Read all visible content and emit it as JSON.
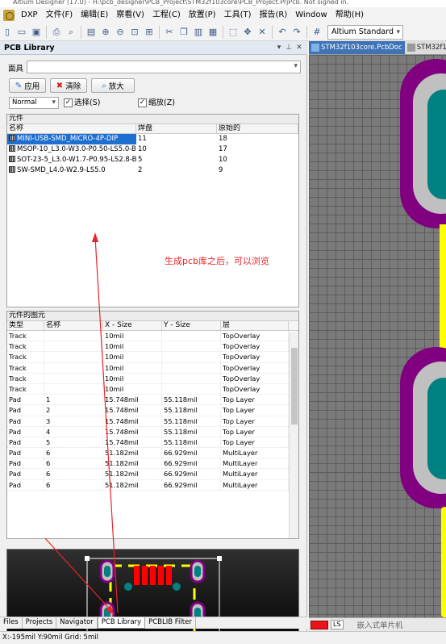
{
  "window": {
    "title_fragment": "Altium Designer (17.0) - H:\\pcb_designer\\PCB_Project\\STM32f103core\\PCB_Project.PrjPcb. Not signed in."
  },
  "menu": [
    "DXP",
    "文件(F)",
    "编辑(E)",
    "察看(V)",
    "工程(C)",
    "放置(P)",
    "工具(T)",
    "报告(R)",
    "Window",
    "帮助(H)"
  ],
  "toolbar": {
    "view_mode": "Altium Standard 2D"
  },
  "panel": {
    "title": "PCB Library",
    "mask_label": "面具",
    "mask_value": "",
    "buttons": {
      "apply": "应用",
      "clear": "清除",
      "magnify": "放大"
    },
    "mode": "Normal",
    "checkbox_select": "选择(S)",
    "checkbox_zoom": "缩放(Z)",
    "components": {
      "group_title": "元件",
      "columns": [
        "名称",
        "焊盘",
        "原始的"
      ],
      "rows": [
        {
          "name": "MINI-USB-SMD_MICRO-4P-DIP",
          "pads": "11",
          "primitives": "18",
          "selected": true
        },
        {
          "name": "MSOP-10_L3.0-W3.0-P0.50-LS5.0-BL",
          "pads": "10",
          "primitives": "17",
          "selected": false
        },
        {
          "name": "SOT-23-5_L3.0-W1.7-P0.95-LS2.8-BR",
          "pads": "5",
          "primitives": "10",
          "selected": false
        },
        {
          "name": "SW-SMD_L4.0-W2.9-LS5.0",
          "pads": "2",
          "primitives": "9",
          "selected": false
        }
      ]
    },
    "annotation": "生成pcb库之后，可以浏览",
    "primitives": {
      "group_title": "元件的图元",
      "columns": [
        "类型",
        "名称",
        "X - Size",
        "Y - Size",
        "层"
      ],
      "rows": [
        {
          "type": "Track",
          "name": "",
          "x": "10mil",
          "y": "",
          "layer": "TopOverlay"
        },
        {
          "type": "Track",
          "name": "",
          "x": "10mil",
          "y": "",
          "layer": "TopOverlay"
        },
        {
          "type": "Track",
          "name": "",
          "x": "10mil",
          "y": "",
          "layer": "TopOverlay"
        },
        {
          "type": "Track",
          "name": "",
          "x": "10mil",
          "y": "",
          "layer": "TopOverlay"
        },
        {
          "type": "Track",
          "name": "",
          "x": "10mil",
          "y": "",
          "layer": "TopOverlay"
        },
        {
          "type": "Track",
          "name": "",
          "x": "10mil",
          "y": "",
          "layer": "TopOverlay"
        },
        {
          "type": "Pad",
          "name": "1",
          "x": "15.748mil",
          "y": "55.118mil",
          "layer": "Top Layer"
        },
        {
          "type": "Pad",
          "name": "2",
          "x": "15.748mil",
          "y": "55.118mil",
          "layer": "Top Layer"
        },
        {
          "type": "Pad",
          "name": "3",
          "x": "15.748mil",
          "y": "55.118mil",
          "layer": "Top Layer"
        },
        {
          "type": "Pad",
          "name": "4",
          "x": "15.748mil",
          "y": "55.118mil",
          "layer": "Top Layer"
        },
        {
          "type": "Pad",
          "name": "5",
          "x": "15.748mil",
          "y": "55.118mil",
          "layer": "Top Layer"
        },
        {
          "type": "Pad",
          "name": "6",
          "x": "51.182mil",
          "y": "66.929mil",
          "layer": "MultiLayer"
        },
        {
          "type": "Pad",
          "name": "6",
          "x": "51.182mil",
          "y": "66.929mil",
          "layer": "MultiLayer"
        },
        {
          "type": "Pad",
          "name": "6",
          "x": "51.182mil",
          "y": "66.929mil",
          "layer": "MultiLayer"
        },
        {
          "type": "Pad",
          "name": "6",
          "x": "51.182mil",
          "y": "66.929mil",
          "layer": "MultiLayer"
        }
      ]
    },
    "tabs": [
      "Files",
      "Projects",
      "Navigator",
      "PCB Library",
      "PCBLIB Filter"
    ],
    "active_tab": "PCB Library"
  },
  "editor": {
    "tabs": [
      {
        "label": "STM32f103core.PcbDoc",
        "active": true
      },
      {
        "label": "STM32f1",
        "active": false
      }
    ],
    "layer_label": "LS",
    "watermark": "嵌入式单片机"
  },
  "status": "X:-195mil Y:90mil   Grid: 5mil",
  "colors": {
    "accent": "#1f6fd0",
    "annotation": "#e8242a",
    "pad_yellow": "#ffff00",
    "pad_purple": "#800080",
    "pad_gray": "#c0c0c0",
    "layer_swatch": "#e8141b"
  }
}
